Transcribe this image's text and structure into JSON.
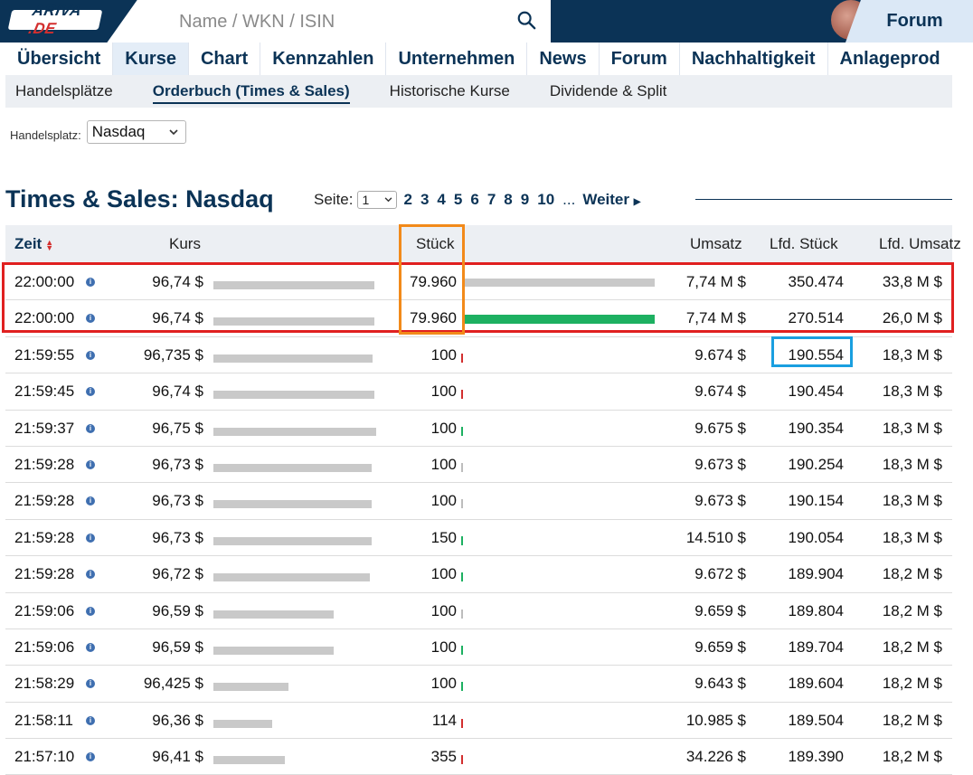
{
  "brand": {
    "logo_text": "ARIVA",
    "logo_suffix": ".DE"
  },
  "search": {
    "placeholder": "Name / WKN / ISIN"
  },
  "header": {
    "forum_label": "Forum"
  },
  "nav": {
    "items": [
      "Übersicht",
      "Kurse",
      "Chart",
      "Kennzahlen",
      "Unternehmen",
      "News",
      "Forum",
      "Nachhaltigkeit",
      "Anlageprod"
    ],
    "active": "Kurse"
  },
  "subnav": {
    "items": [
      "Handelsplätze",
      "Orderbuch (Times & Sales)",
      "Historische Kurse",
      "Dividende & Split"
    ],
    "active": "Orderbuch (Times & Sales)"
  },
  "handelsplatz": {
    "label": "Handelsplatz:",
    "value": "Nasdaq"
  },
  "section": {
    "title": "Times & Sales: Nasdaq"
  },
  "pager": {
    "label": "Seite:",
    "current": "1",
    "pages": [
      "2",
      "3",
      "4",
      "5",
      "6",
      "7",
      "8",
      "9",
      "10"
    ],
    "ellipsis": "...",
    "next": "Weiter"
  },
  "table": {
    "headers": {
      "zeit": "Zeit",
      "kurs": "Kurs",
      "stueck": "Stück",
      "umsatz": "Umsatz",
      "lfd_stueck": "Lfd. Stück",
      "lfd_umsatz": "Lfd. Umsatz"
    },
    "rows": [
      {
        "zeit": "22:00:00",
        "kurs": "96,74 $",
        "stueck": "79.960",
        "umsatz": "7,74 M $",
        "lfd_stueck": "350.474",
        "lfd_umsatz": "33,8 M $",
        "kurs_level": 0.99,
        "vol_level": 1.0,
        "vol_color": "#c9c9c9",
        "tick": "none"
      },
      {
        "zeit": "22:00:00",
        "kurs": "96,74 $",
        "stueck": "79.960",
        "umsatz": "7,74 M $",
        "lfd_stueck": "270.514",
        "lfd_umsatz": "26,0 M $",
        "kurs_level": 0.99,
        "vol_level": 1.0,
        "vol_color": "#1db061",
        "tick": "none"
      },
      {
        "zeit": "21:59:55",
        "kurs": "96,735 $",
        "stueck": "100",
        "umsatz": "9.674 $",
        "lfd_stueck": "190.554",
        "lfd_umsatz": "18,3 M $",
        "kurs_level": 0.98,
        "tick": "down"
      },
      {
        "zeit": "21:59:45",
        "kurs": "96,74 $",
        "stueck": "100",
        "umsatz": "9.674 $",
        "lfd_stueck": "190.454",
        "lfd_umsatz": "18,3 M $",
        "kurs_level": 0.99,
        "tick": "down"
      },
      {
        "zeit": "21:59:37",
        "kurs": "96,75 $",
        "stueck": "100",
        "umsatz": "9.675 $",
        "lfd_stueck": "190.354",
        "lfd_umsatz": "18,3 M $",
        "kurs_level": 1.0,
        "tick": "up"
      },
      {
        "zeit": "21:59:28",
        "kurs": "96,73 $",
        "stueck": "100",
        "umsatz": "9.673 $",
        "lfd_stueck": "190.254",
        "lfd_umsatz": "18,3 M $",
        "kurs_level": 0.97,
        "tick": "flat"
      },
      {
        "zeit": "21:59:28",
        "kurs": "96,73 $",
        "stueck": "100",
        "umsatz": "9.673 $",
        "lfd_stueck": "190.154",
        "lfd_umsatz": "18,3 M $",
        "kurs_level": 0.97,
        "tick": "flat"
      },
      {
        "zeit": "21:59:28",
        "kurs": "96,73 $",
        "stueck": "150",
        "umsatz": "14.510 $",
        "lfd_stueck": "190.054",
        "lfd_umsatz": "18,3 M $",
        "kurs_level": 0.97,
        "tick": "up"
      },
      {
        "zeit": "21:59:28",
        "kurs": "96,72 $",
        "stueck": "100",
        "umsatz": "9.672 $",
        "lfd_stueck": "189.904",
        "lfd_umsatz": "18,2 M $",
        "kurs_level": 0.96,
        "tick": "up"
      },
      {
        "zeit": "21:59:06",
        "kurs": "96,59 $",
        "stueck": "100",
        "umsatz": "9.659 $",
        "lfd_stueck": "189.804",
        "lfd_umsatz": "18,2 M $",
        "kurs_level": 0.74,
        "tick": "flat"
      },
      {
        "zeit": "21:59:06",
        "kurs": "96,59 $",
        "stueck": "100",
        "umsatz": "9.659 $",
        "lfd_stueck": "189.704",
        "lfd_umsatz": "18,2 M $",
        "kurs_level": 0.74,
        "tick": "up"
      },
      {
        "zeit": "21:58:29",
        "kurs": "96,425 $",
        "stueck": "100",
        "umsatz": "9.643 $",
        "lfd_stueck": "189.604",
        "lfd_umsatz": "18,2 M $",
        "kurs_level": 0.46,
        "tick": "up"
      },
      {
        "zeit": "21:58:11",
        "kurs": "96,36 $",
        "stueck": "114",
        "umsatz": "10.985 $",
        "lfd_stueck": "189.504",
        "lfd_umsatz": "18,2 M $",
        "kurs_level": 0.36,
        "tick": "down"
      },
      {
        "zeit": "21:57:10",
        "kurs": "96,41 $",
        "stueck": "355",
        "umsatz": "34.226 $",
        "lfd_stueck": "189.390",
        "lfd_umsatz": "18,2 M $",
        "kurs_level": 0.44,
        "tick": "down"
      }
    ]
  },
  "colors": {
    "brand": "#0b3356",
    "up": "#1db061",
    "down": "#d32f2f",
    "flat": "#bdbdbd",
    "highlight_red": "#e02020",
    "highlight_orange": "#f28a1a",
    "highlight_blue": "#1a9fe0"
  }
}
